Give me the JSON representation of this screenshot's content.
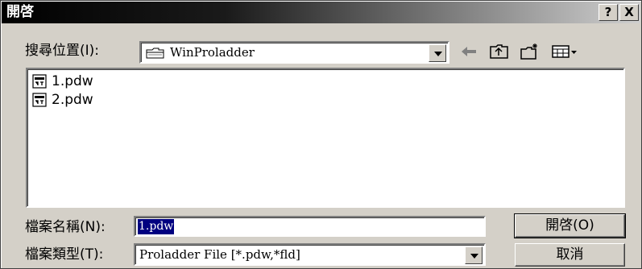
{
  "window": {
    "title": "開啓",
    "help_label": "?",
    "close_label": "X"
  },
  "lookin": {
    "label": "搜尋位置(I):",
    "value": "WinProladder",
    "icon": "folder-icon"
  },
  "toolbar": {
    "back_icon": "back-arrow-icon",
    "up_icon": "up-one-level-icon",
    "new_folder_icon": "new-folder-icon",
    "view_icon": "view-menu-icon"
  },
  "files": [
    {
      "name": "1.pdw",
      "icon": "pdw-file-icon"
    },
    {
      "name": "2.pdw",
      "icon": "pdw-file-icon"
    }
  ],
  "filename": {
    "label": "檔案名稱(N):",
    "value": "1.pdw"
  },
  "filetype": {
    "label": "檔案類型(T):",
    "value": "Proladder File [*.pdw,*fld]"
  },
  "buttons": {
    "open_label": "開啓(O)",
    "cancel_label": "取消"
  }
}
